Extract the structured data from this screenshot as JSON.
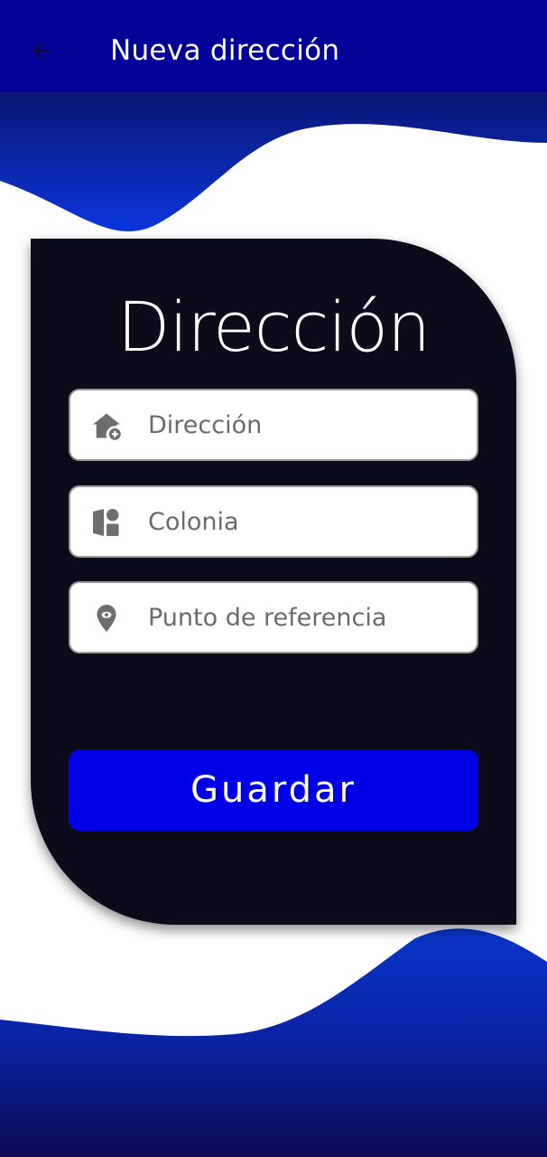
{
  "appbar": {
    "title": "Nueva dirección",
    "back_icon": "arrow-left-icon"
  },
  "card": {
    "title": "Dirección"
  },
  "form": {
    "fields": [
      {
        "icon": "add-home-icon",
        "placeholder": "Dirección",
        "value": ""
      },
      {
        "icon": "neighborhood-shapes-icon",
        "placeholder": "Colonia",
        "value": ""
      },
      {
        "icon": "location-pin-icon",
        "placeholder": "Punto de referencia",
        "value": ""
      }
    ],
    "save_label": "Guardar"
  },
  "colors": {
    "appbar": "#020299",
    "wave_gradient_top": "#0a1470",
    "wave_gradient_bottom": "#0a34d8",
    "card_background": "#0b0b1a",
    "button": "#0000e6",
    "icon": "#6e6e6e"
  }
}
